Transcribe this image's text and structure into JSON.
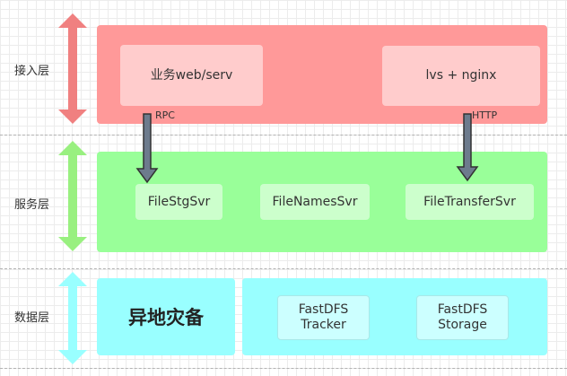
{
  "layers": [
    {
      "label": "接入层",
      "color": "#f08080"
    },
    {
      "label": "服务层",
      "color": "#99f080"
    },
    {
      "label": "数据层",
      "color": "#99ffff"
    }
  ],
  "access": {
    "band_color": "#ff9999",
    "box_color": "#ffcccc",
    "boxes": [
      "业务web/serv",
      "lvs + nginx"
    ]
  },
  "service": {
    "band_color": "#99ff99",
    "box_color": "#ccffcc",
    "boxes": [
      "FileStgSvr",
      "FileNamesSvr",
      "FileTransferSvr"
    ]
  },
  "data": {
    "band_color": "#99ffff",
    "box_color": "#ccffff",
    "disaster_recovery": "异地灾备",
    "fastdfs": [
      {
        "line1": "FastDFS",
        "line2": "Tracker"
      },
      {
        "line1": "FastDFS",
        "line2": "Storage"
      }
    ]
  },
  "edges": [
    {
      "label": "RPC",
      "color": "#6d7b8d"
    },
    {
      "label": "HTTP",
      "color": "#6d7b8d"
    }
  ]
}
